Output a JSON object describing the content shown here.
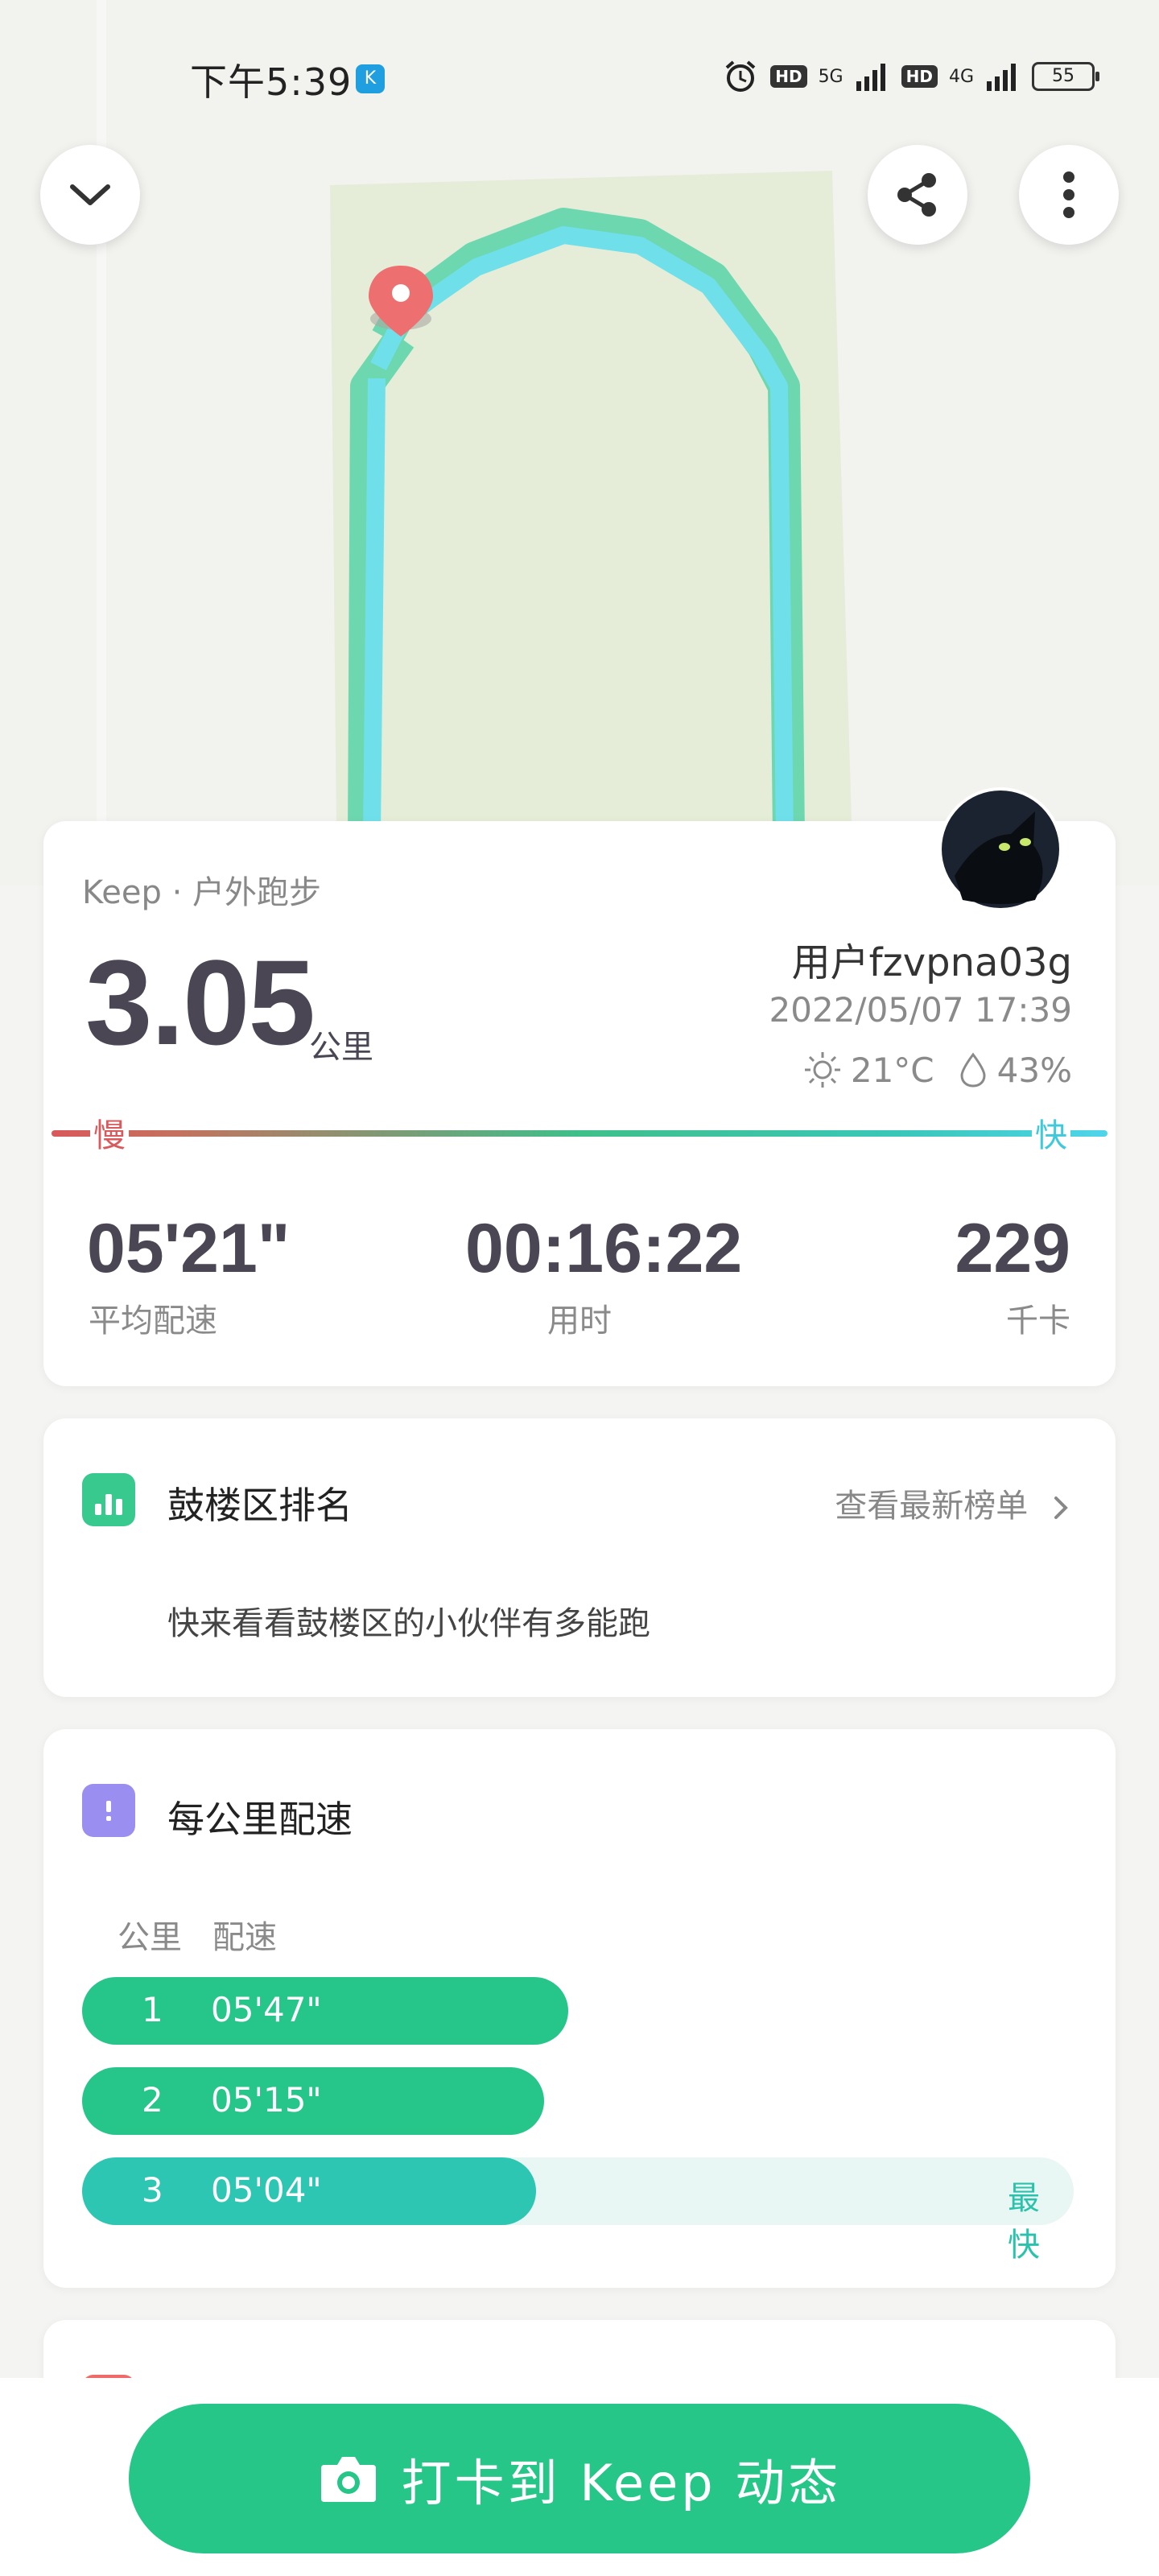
{
  "status_bar": {
    "time": "下午5:39",
    "app_badge": "K",
    "network_1": "5G",
    "network_2": "4G",
    "hd": "HD",
    "battery": "55"
  },
  "top_buttons": {
    "collapse_icon": "chevron-down-icon",
    "share_icon": "share-icon",
    "more_icon": "more-vertical-icon"
  },
  "summary": {
    "source": "Keep · 户外跑步",
    "distance": "3.05",
    "distance_unit": "公里",
    "user_name": "用户fzvpna03g",
    "datetime": "2022/05/07 17:39",
    "temperature": "21°C",
    "humidity": "43%",
    "pace_slow_label": "慢",
    "pace_fast_label": "快",
    "stats": [
      {
        "value": "05'21\"",
        "label": "平均配速"
      },
      {
        "value": "00:16:22",
        "label": "用时"
      },
      {
        "value": "229",
        "label": "千卡"
      }
    ]
  },
  "ranking": {
    "title": "鼓楼区排名",
    "link": "查看最新榜单",
    "description": "快来看看鼓楼区的小伙伴有多能跑"
  },
  "pace_per_km": {
    "title": "每公里配速",
    "col_km": "公里",
    "col_pace": "配速",
    "rows": [
      {
        "km": "1",
        "pace": "05'47\"",
        "fill": 0.49
      },
      {
        "km": "2",
        "pace": "05'15\"",
        "fill": 0.466
      },
      {
        "km": "3",
        "pace": "05'04\"",
        "fill": 0.458,
        "tag": "最快"
      }
    ]
  },
  "cta": {
    "label": "打卡到 Keep 动态"
  },
  "colors": {
    "brand_green": "#25c688",
    "slow_red": "#d9595c",
    "fast_cyan": "#4fd4ea",
    "track_cyan": "#6fe0ea"
  }
}
